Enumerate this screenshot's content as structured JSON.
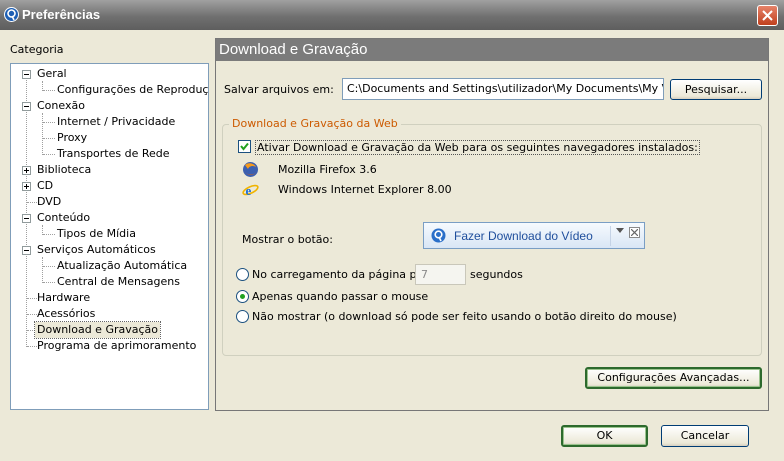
{
  "window": {
    "title": "Preferências"
  },
  "sidebar": {
    "label": "Categoria",
    "items": [
      {
        "label": "Geral"
      },
      {
        "label": "Configurações de Reprodução"
      },
      {
        "label": "Conexão"
      },
      {
        "label": "Internet / Privacidade"
      },
      {
        "label": "Proxy"
      },
      {
        "label": "Transportes de Rede"
      },
      {
        "label": "Biblioteca"
      },
      {
        "label": "CD"
      },
      {
        "label": "DVD"
      },
      {
        "label": "Conteúdo"
      },
      {
        "label": "Tipos de Mídia"
      },
      {
        "label": "Serviços Automáticos"
      },
      {
        "label": "Atualização Automática"
      },
      {
        "label": "Central de Mensagens"
      },
      {
        "label": "Hardware"
      },
      {
        "label": "Acessórios"
      },
      {
        "label": "Download e Gravação"
      },
      {
        "label": "Programa de aprimoramento"
      }
    ]
  },
  "panel": {
    "title": "Download e Gravação",
    "save_label": "Salvar arquivos em:",
    "save_path": "C:\\Documents and Settings\\utilizador\\My Documents\\My Videos\\",
    "browse_label": "Pesquisar...",
    "group_title": "Download e Gravação da Web",
    "enable_label": "Ativar Download e Gravação da Web para os seguintes navegadores instalados:",
    "enable_checked": true,
    "browsers": [
      {
        "name": "Mozilla Firefox 3.6",
        "icon": "firefox-icon"
      },
      {
        "name": "Windows Internet Explorer 8.00",
        "icon": "internet-explorer-icon"
      }
    ],
    "show_button_label": "Mostrar o botão:",
    "download_button_label": "Fazer Download do Vídeo",
    "options": {
      "on_load_label": "No carregamento da página por",
      "seconds_value": "7",
      "seconds_label": "segundos",
      "hover_label": "Apenas quando passar o mouse",
      "hide_label": "Não mostrar (o download só pode ser feito usando o botão direito do mouse)",
      "selected": "hover"
    },
    "advanced_label": "Configurações Avançadas..."
  },
  "footer": {
    "ok_label": "OK",
    "cancel_label": "Cancelar"
  }
}
